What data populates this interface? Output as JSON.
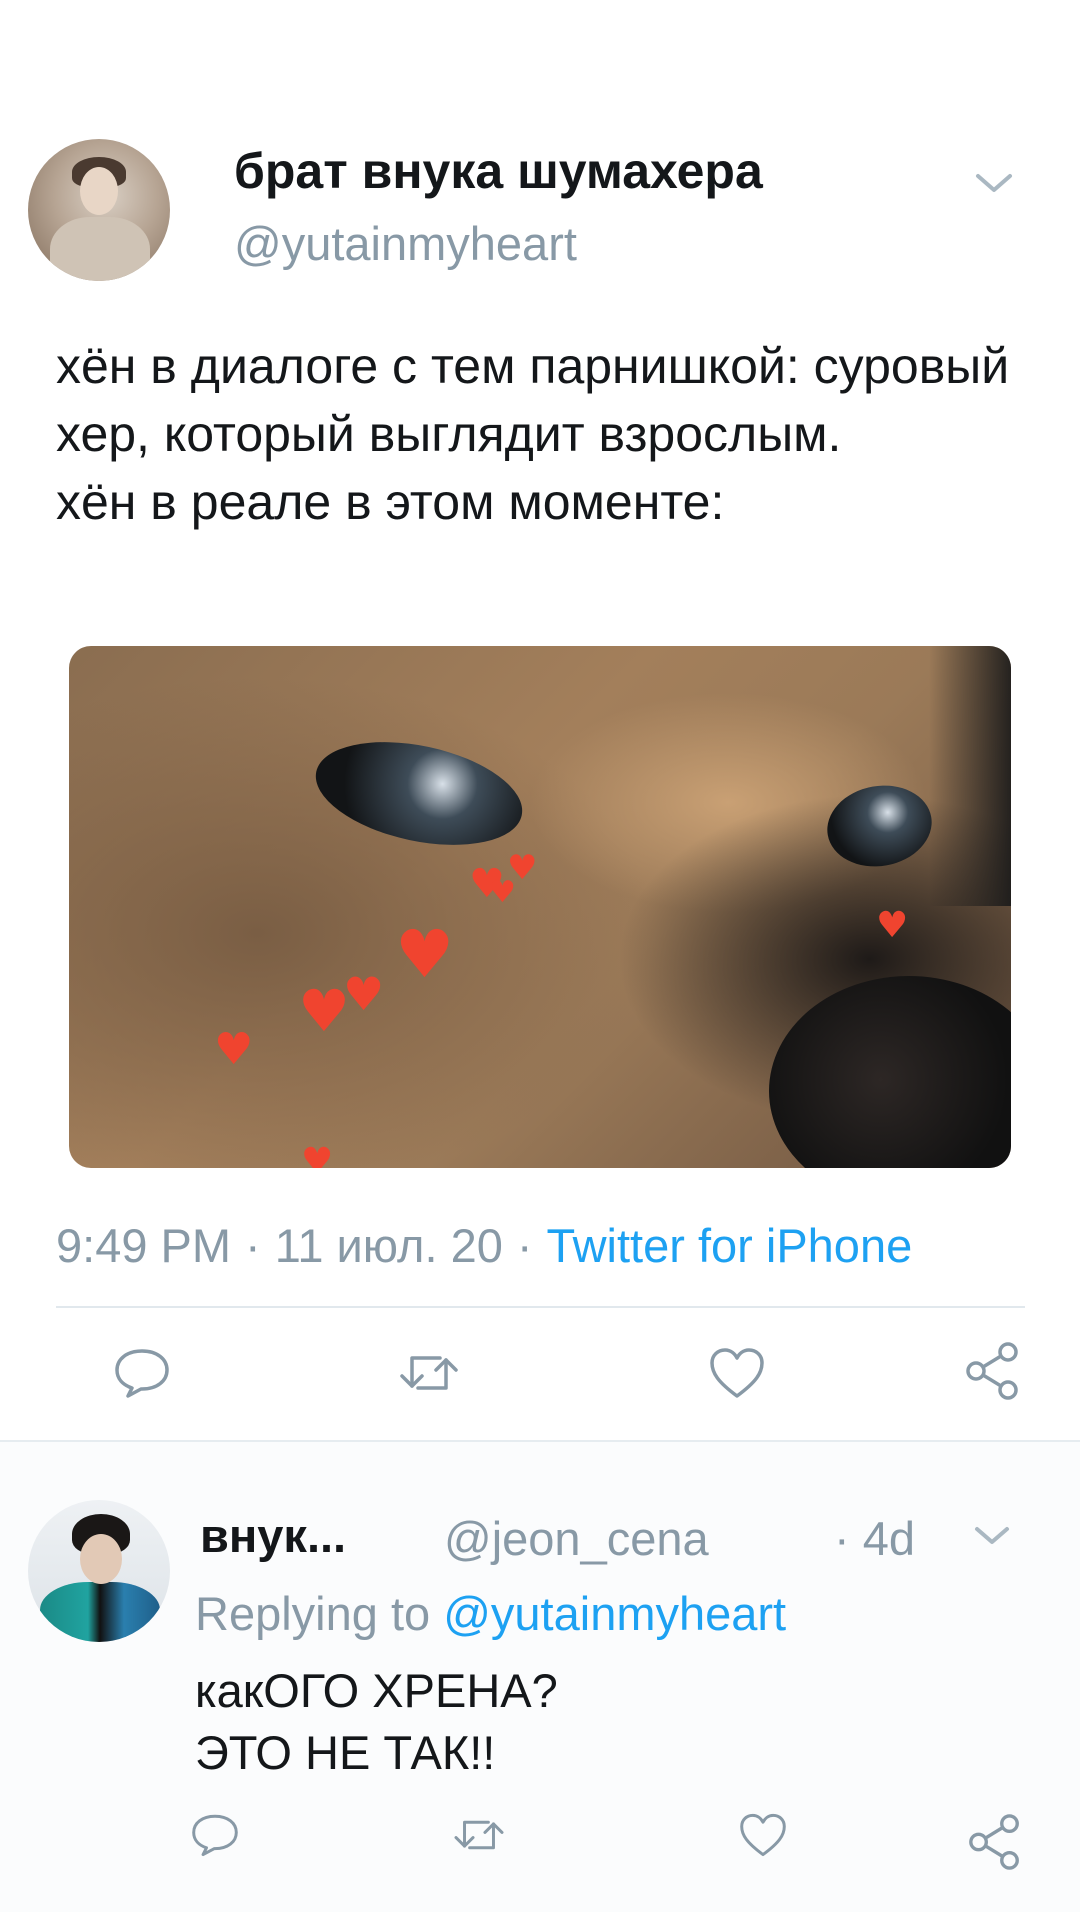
{
  "tweet": {
    "author_name": "брат внука шумахера",
    "author_handle": "@yutainmyheart",
    "text": "хён в диалоге с тем парнишкой: суровый хер, который выглядит взрослым.\nхён в реале в этом моменте:",
    "time": "9:49 PM",
    "date": "11 июл. 20",
    "separator": "·",
    "source": "Twitter for iPhone",
    "actions": [
      "reply-icon",
      "retweet-icon",
      "like-icon",
      "share-icon"
    ]
  },
  "reply": {
    "author_name": "внук...",
    "author_handle": "@jeon_cena",
    "time": "· 4d",
    "replying_prefix": "Replying to",
    "replying_mention": "@yutainmyheart",
    "text": "какОГО ХРЕНА?\nЭТО НЕ ТАК!!",
    "actions": [
      "reply-icon",
      "retweet-icon",
      "like-icon",
      "share-icon"
    ]
  },
  "colors": {
    "accent": "#1da1f2",
    "secondary_text": "#8899a6",
    "primary_text": "#14171a",
    "divider": "#e1e8ed",
    "hearts": "#f0442f"
  }
}
